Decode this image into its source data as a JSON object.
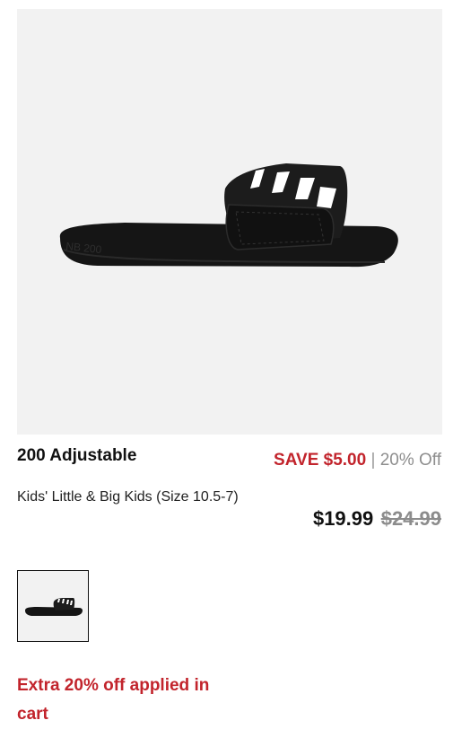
{
  "product": {
    "name": "200 Adjustable",
    "subtitle": "Kids' Little & Big Kids (Size 10.5-7)",
    "image_icon": "sandal-slide-image"
  },
  "pricing": {
    "save_label": "SAVE $5.00",
    "separator": "|",
    "discount_text": "20% Off",
    "current_price": "$19.99",
    "original_price": "$24.99",
    "accent_color": "#c2242c"
  },
  "gallery": {
    "thumbnail_icon": "sandal-thumbnail-image"
  },
  "promo": {
    "text": "Extra 20% off applied in cart"
  }
}
